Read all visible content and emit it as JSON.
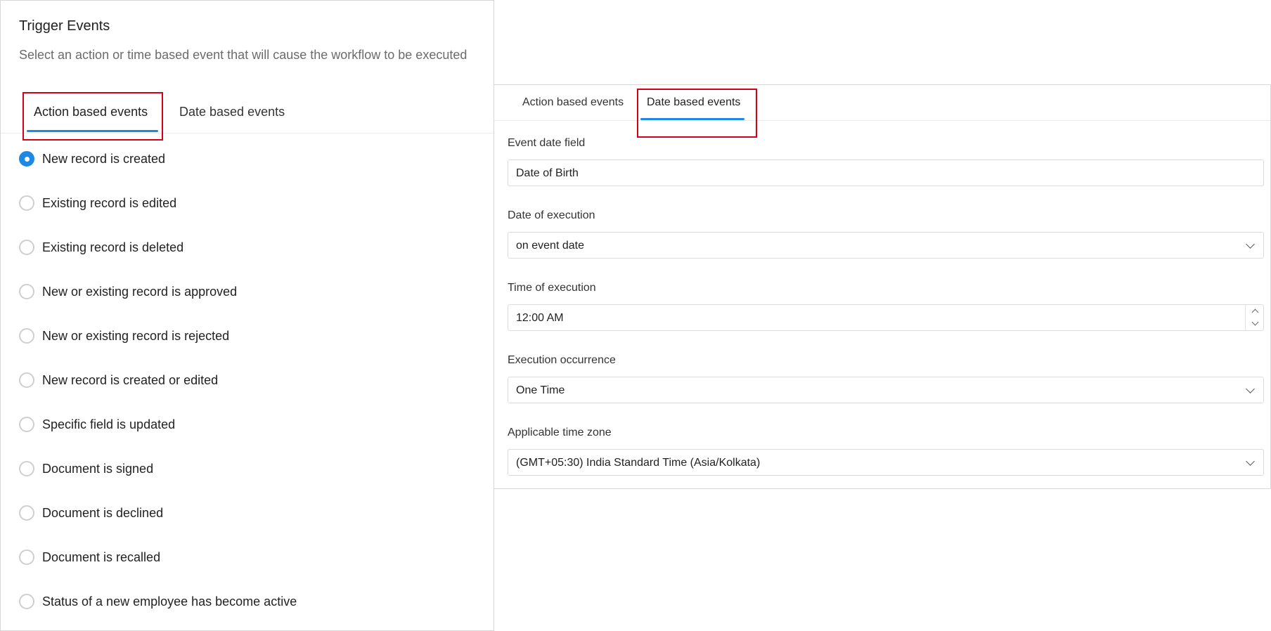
{
  "left_panel": {
    "title": "Trigger Events",
    "subtitle": "Select an action or time based event that will cause the workflow to be executed",
    "tabs": [
      {
        "label": "Action based events",
        "active": true
      },
      {
        "label": "Date based events",
        "active": false
      }
    ],
    "options": [
      {
        "label": "New record is created",
        "selected": true
      },
      {
        "label": "Existing record is edited",
        "selected": false
      },
      {
        "label": "Existing record is deleted",
        "selected": false
      },
      {
        "label": "New or existing record is approved",
        "selected": false
      },
      {
        "label": "New or existing record is rejected",
        "selected": false
      },
      {
        "label": "New record is created or edited",
        "selected": false
      },
      {
        "label": "Specific field is updated",
        "selected": false
      },
      {
        "label": "Document is signed",
        "selected": false
      },
      {
        "label": "Document is declined",
        "selected": false
      },
      {
        "label": "Document is recalled",
        "selected": false
      },
      {
        "label": "Status of a new employee has become active",
        "selected": false
      }
    ]
  },
  "right_panel": {
    "tabs": [
      {
        "label": "Action based events",
        "active": false
      },
      {
        "label": "Date based events",
        "active": true
      }
    ],
    "fields": {
      "event_date_field": {
        "label": "Event date field",
        "value": "Date of Birth"
      },
      "date_of_execution": {
        "label": "Date of execution",
        "value": "on event date"
      },
      "time_of_execution": {
        "label": "Time of execution",
        "value": "12:00 AM"
      },
      "execution_occurrence": {
        "label": "Execution occurrence",
        "value": "One Time"
      },
      "applicable_time_zone": {
        "label": "Applicable time zone",
        "value": "(GMT+05:30) India Standard Time (Asia/Kolkata)"
      }
    }
  },
  "icons": {
    "dropdown": "chevron-down-icon",
    "stepper_up": "chevron-up-icon",
    "stepper_down": "chevron-down-icon"
  },
  "colors": {
    "accent": "#1e88e5",
    "highlight_border": "#d0021b",
    "border": "#d6d6d6",
    "subtitle_text": "#6b6b6b"
  }
}
